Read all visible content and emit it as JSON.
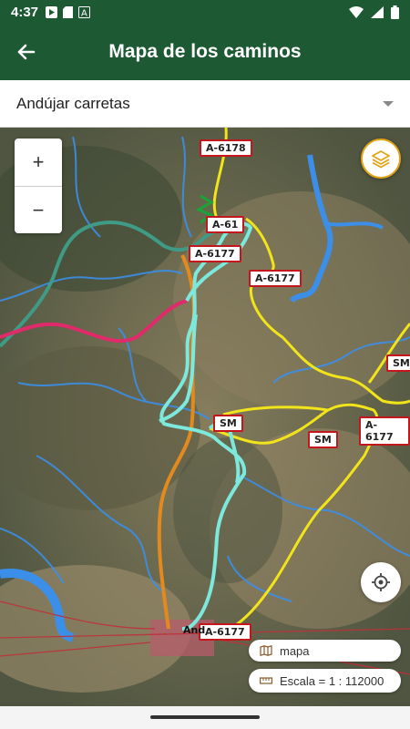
{
  "status_bar": {
    "time": "4:37"
  },
  "app_bar": {
    "title": "Mapa de los caminos"
  },
  "selector": {
    "value": "Andújar carretas"
  },
  "map": {
    "zoom_in": "+",
    "zoom_out": "−",
    "road_labels": [
      "A-6178",
      "A-61",
      "A-6177",
      "A-6177",
      "SM",
      "SM",
      "A-6177",
      "SM",
      "A-6177",
      "And"
    ],
    "pill_map_label": "mapa",
    "pill_scale_label": "Escala = 1 : 112000"
  },
  "colors": {
    "header": "#1d5a34",
    "route_cyan": "#7de8dc",
    "route_orange": "#e38a1f",
    "route_teal": "#3f9b86",
    "route_pink": "#e02a6a",
    "road_yellow": "#f2e41a",
    "river_blue": "#3c8fe8"
  },
  "icons": [
    "back-arrow-icon",
    "layers-icon",
    "locate-icon",
    "map-icon",
    "scale-ruler-icon"
  ]
}
